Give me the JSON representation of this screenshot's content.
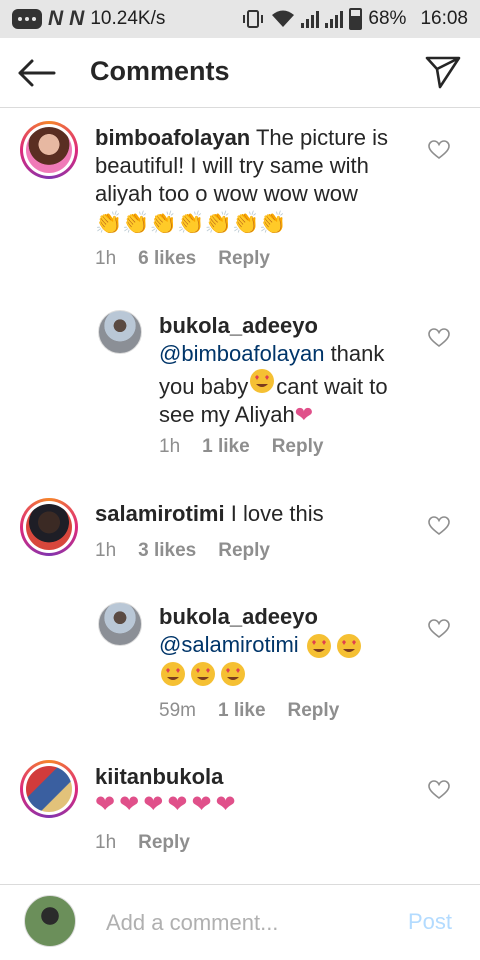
{
  "status_bar": {
    "network_speed": "10.24K/s",
    "battery": "68%",
    "time": "16:08",
    "n_badge": "N"
  },
  "header": {
    "title": "Comments"
  },
  "comments": [
    {
      "username": "bimboafolayan",
      "text": "The picture is beautiful! I will try same with aliyah too o wow wow wow",
      "emojis": "👏👏👏👏👏👏👏",
      "time": "1h",
      "likes": "6 likes",
      "reply": "Reply"
    },
    {
      "username": "bukola_adeeyo",
      "mention": "@bimboafolayan",
      "text_a": "thank you baby",
      "text_b": "cant wait to see my Aliyah",
      "time": "1h",
      "likes": "1 like",
      "reply": "Reply"
    },
    {
      "username": "salamirotimi",
      "text": "I love this",
      "time": "1h",
      "likes": "3 likes",
      "reply": "Reply"
    },
    {
      "username": "bukola_adeeyo",
      "mention": "@salamirotimi",
      "time": "59m",
      "likes": "1 like",
      "reply": "Reply"
    },
    {
      "username": "kiitanbukola",
      "time": "1h",
      "reply": "Reply"
    }
  ],
  "composer": {
    "placeholder": "Add a comment...",
    "post_label": "Post"
  },
  "colors": {
    "text": "#262626",
    "muted": "#8e8e8e",
    "mention": "#003569",
    "post_disabled": "#b3dbff",
    "heart_emoji": "#e0508a"
  }
}
